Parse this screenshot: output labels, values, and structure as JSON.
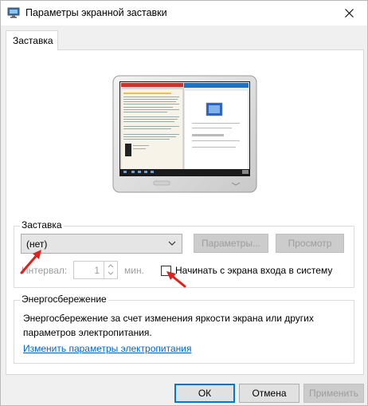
{
  "window": {
    "title": "Параметры экранной заставки"
  },
  "tabs": [
    {
      "label": "Заставка"
    }
  ],
  "screensaver_group": {
    "title": "Заставка",
    "selected": "(нет)",
    "params_button": "Параметры...",
    "preview_button": "Просмотр",
    "interval_label": "Интервал:",
    "interval_value": "1",
    "minutes_label": "мин.",
    "logon_checkbox_label": "Начинать с экрана входа в систему",
    "logon_checked": false
  },
  "energy_group": {
    "title": "Энергосбережение",
    "description": "Энергосбережение за счет изменения яркости экрана или других параметров электропитания.",
    "link": "Изменить параметры электропитания"
  },
  "footer": {
    "ok": "ОК",
    "cancel": "Отмена",
    "apply": "Применить"
  },
  "colors": {
    "accent": "#0078d7",
    "link": "#0066cc",
    "annotation_arrow": "#e0201c"
  }
}
